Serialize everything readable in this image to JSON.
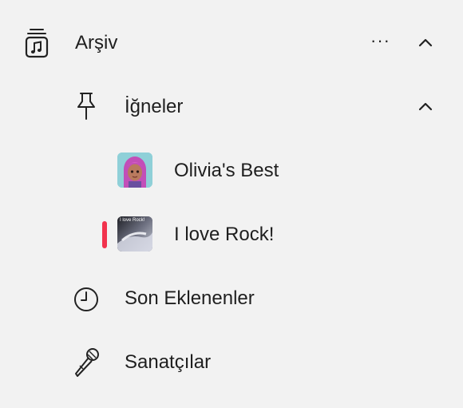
{
  "library": {
    "title": "Arşiv",
    "icon": "music-library-icon",
    "more_label": "···",
    "expanded_icon": "chevron-up-icon"
  },
  "pins": {
    "title": "İğneler",
    "icon": "pin-icon",
    "expanded_icon": "chevron-up-icon",
    "items": [
      {
        "label": "Olivia's Best",
        "art": "avatar-artwork"
      },
      {
        "label": "I love Rock!",
        "art_caption": "I love Rock!",
        "playing": true
      }
    ]
  },
  "recently_added": {
    "label": "Son Eklenenler",
    "icon": "clock-icon"
  },
  "artists": {
    "label": "Sanatçılar",
    "icon": "microphone-icon"
  },
  "colors": {
    "accent": "#f2324d",
    "background": "#f2f2f2"
  }
}
